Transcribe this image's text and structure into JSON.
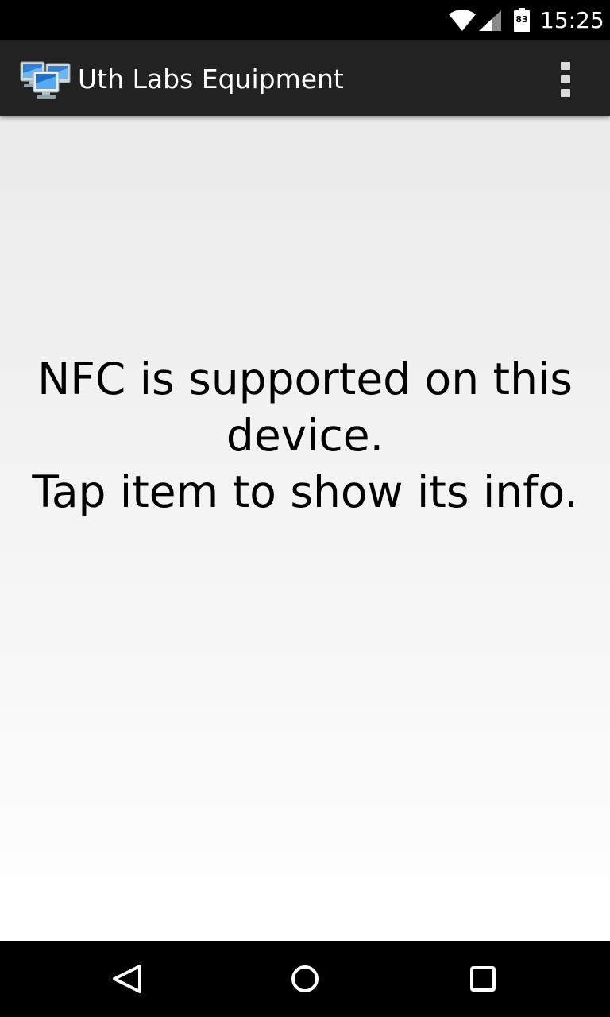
{
  "status_bar": {
    "time": "15:25",
    "battery_level": "83",
    "icons": [
      "wifi-icon",
      "cell-signal-icon",
      "battery-icon"
    ]
  },
  "action_bar": {
    "title": "Uth Labs Equipment",
    "app_icon": "computers-network-icon",
    "overflow_icon": "overflow-menu-icon"
  },
  "main": {
    "message_lines": [
      "NFC is supported on this",
      "device.",
      "Tap item to show its info."
    ]
  },
  "nav_bar": {
    "buttons": [
      "back-icon",
      "home-icon",
      "recents-icon"
    ]
  },
  "colors": {
    "action_bar_bg": "#222222",
    "status_bar_bg": "#000000",
    "nav_bar_bg": "#000000",
    "text": "#000000"
  }
}
